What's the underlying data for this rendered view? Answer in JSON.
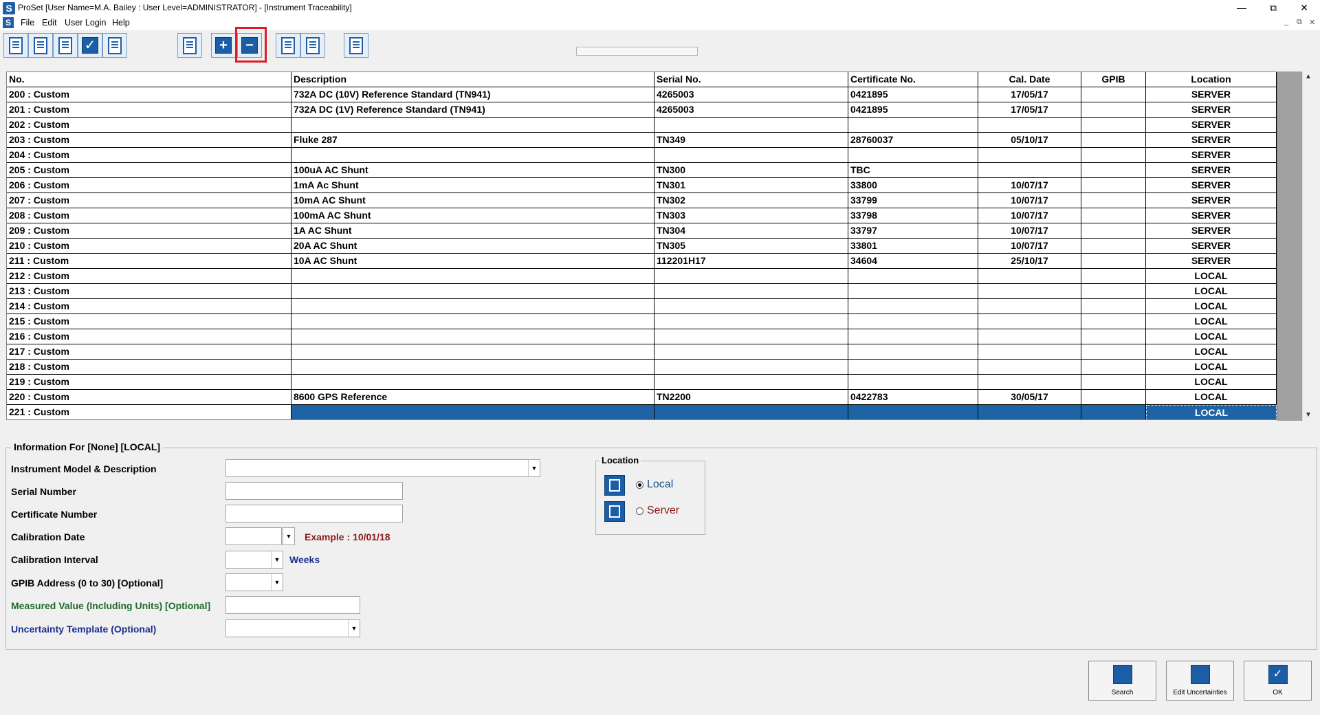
{
  "window": {
    "title": "ProSet [User Name=M.A. Bailey : User Level=ADMINISTRATOR] - [Instrument Traceability]",
    "app_letter": "S",
    "controls": [
      "—",
      "⧉",
      "✕"
    ],
    "mdi_controls": [
      "_",
      "⧉",
      "✕"
    ]
  },
  "menu": [
    "File",
    "Edit",
    "User Login",
    "Help"
  ],
  "toolbar": {
    "buttons": [
      "list-icon",
      "list-icon",
      "copy-icon",
      "check-icon",
      "document-icon",
      "print-icon",
      "add-icon",
      "remove-icon",
      "import-icon",
      "export-icon",
      "edit-icon"
    ],
    "highlighted": "remove-icon",
    "add_glyph": "+",
    "remove_glyph": "−",
    "check_glyph": "✓"
  },
  "table": {
    "columns": [
      "No.",
      "Description",
      "Serial No.",
      "Certificate No.",
      "Cal. Date",
      "GPIB",
      "Location"
    ],
    "rows": [
      [
        "200 : Custom",
        "732A DC (10V) Reference Standard (TN941)",
        "4265003",
        "0421895",
        "17/05/17",
        "",
        "SERVER"
      ],
      [
        "201 : Custom",
        "732A DC (1V) Reference Standard (TN941)",
        "4265003",
        "0421895",
        "17/05/17",
        "",
        "SERVER"
      ],
      [
        "202 : Custom",
        "",
        "",
        "",
        "",
        "",
        "SERVER"
      ],
      [
        "203 : Custom",
        "Fluke 287",
        "TN349",
        "28760037",
        "05/10/17",
        "",
        "SERVER"
      ],
      [
        "204 : Custom",
        "",
        "",
        "",
        "",
        "",
        "SERVER"
      ],
      [
        "205 : Custom",
        "100uA AC Shunt",
        "TN300",
        "TBC",
        "",
        "",
        "SERVER"
      ],
      [
        "206 : Custom",
        "1mA Ac Shunt",
        "TN301",
        "33800",
        "10/07/17",
        "",
        "SERVER"
      ],
      [
        "207 : Custom",
        "10mA AC Shunt",
        "TN302",
        "33799",
        "10/07/17",
        "",
        "SERVER"
      ],
      [
        "208 : Custom",
        "100mA AC Shunt",
        "TN303",
        "33798",
        "10/07/17",
        "",
        "SERVER"
      ],
      [
        "209 : Custom",
        "1A AC Shunt",
        "TN304",
        "33797",
        "10/07/17",
        "",
        "SERVER"
      ],
      [
        "210 : Custom",
        "20A AC Shunt",
        "TN305",
        "33801",
        "10/07/17",
        "",
        "SERVER"
      ],
      [
        "211 : Custom",
        "10A AC Shunt",
        "112201H17",
        "34604",
        "25/10/17",
        "",
        "SERVER"
      ],
      [
        "212 : Custom",
        "",
        "",
        "",
        "",
        "",
        "LOCAL"
      ],
      [
        "213 : Custom",
        "",
        "",
        "",
        "",
        "",
        "LOCAL"
      ],
      [
        "214 : Custom",
        "",
        "",
        "",
        "",
        "",
        "LOCAL"
      ],
      [
        "215 : Custom",
        "",
        "",
        "",
        "",
        "",
        "LOCAL"
      ],
      [
        "216 : Custom",
        "",
        "",
        "",
        "",
        "",
        "LOCAL"
      ],
      [
        "217 : Custom",
        "",
        "",
        "",
        "",
        "",
        "LOCAL"
      ],
      [
        "218 : Custom",
        "",
        "",
        "",
        "",
        "",
        "LOCAL"
      ],
      [
        "219 : Custom",
        "",
        "",
        "",
        "",
        "",
        "LOCAL"
      ],
      [
        "220 : Custom",
        "8600 GPS Reference",
        "TN2200",
        "0422783",
        "30/05/17",
        "",
        "LOCAL"
      ],
      [
        "221 : Custom",
        "",
        "",
        "",
        "",
        "",
        "LOCAL"
      ]
    ],
    "selected_row": 21
  },
  "scrollbar": {
    "up": "▲",
    "down": "▼"
  },
  "info": {
    "title": "Information For [None] [LOCAL]",
    "labels": {
      "model": "Instrument Model & Description",
      "serial": "Serial Number",
      "certificate": "Certificate Number",
      "cal_date": "Calibration Date",
      "interval": "Calibration Interval",
      "gpib": "GPIB Address (0 to 30) [Optional]",
      "measured": "Measured Value (Including Units) [Optional]",
      "uncertainty": "Uncertainty Template (Optional)"
    },
    "dropdown_arrow": "▼",
    "example": "Example : 10/01/18",
    "weeks": "Weeks"
  },
  "location": {
    "title": "Location",
    "local": "Local",
    "server": "Server",
    "selected": "Local",
    "colors": {
      "local": "#1c4f8f",
      "server": "#8b1a1a"
    }
  },
  "buttons": {
    "search": "Search",
    "edit_uncertainties": "Edit Uncertainties",
    "ok": "OK"
  },
  "colors": {
    "accent": "#1b5ea6",
    "selection": "#1e63a4",
    "highlight_box": "#e01b24"
  }
}
